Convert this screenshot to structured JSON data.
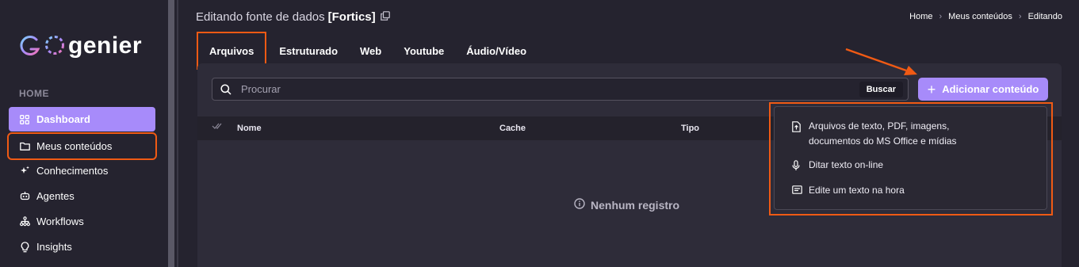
{
  "app": {
    "logo_text": "genier"
  },
  "sidebar": {
    "section": "HOME",
    "items": [
      {
        "label": "Dashboard",
        "icon": "grid-icon"
      },
      {
        "label": "Meus conteúdos",
        "icon": "folder-icon"
      },
      {
        "label": "Conhecimentos",
        "icon": "sparkle-icon"
      },
      {
        "label": "Agentes",
        "icon": "robot-icon"
      },
      {
        "label": "Workflows",
        "icon": "workflow-icon"
      },
      {
        "label": "Insights",
        "icon": "lightbulb-icon"
      }
    ]
  },
  "header": {
    "title_prefix": "Editando fonte de dados",
    "title_name": "[Fortics]",
    "breadcrumb": [
      "Home",
      "Meus conteúdos",
      "Editando"
    ]
  },
  "tabs": [
    "Arquivos",
    "Estruturado",
    "Web",
    "Youtube",
    "Áudio/Vídeo"
  ],
  "search": {
    "placeholder": "Procurar",
    "button": "Buscar"
  },
  "add_button": "Adicionar conteúdo",
  "table": {
    "columns": [
      "Nome",
      "Cache",
      "Tipo"
    ],
    "empty_text": "Nenhum registro"
  },
  "dropdown": {
    "items": [
      {
        "line1": "Arquivos de texto, PDF, imagens,",
        "line2": "documentos do MS Office e mídias",
        "icon": "file-upload-icon"
      },
      {
        "line1": "Ditar texto on-line",
        "icon": "microphone-icon"
      },
      {
        "line1": "Edite um texto na hora",
        "icon": "text-note-icon"
      }
    ]
  },
  "colors": {
    "accent": "#a78bfa",
    "highlight": "#f05a14",
    "background": "#25232f"
  }
}
